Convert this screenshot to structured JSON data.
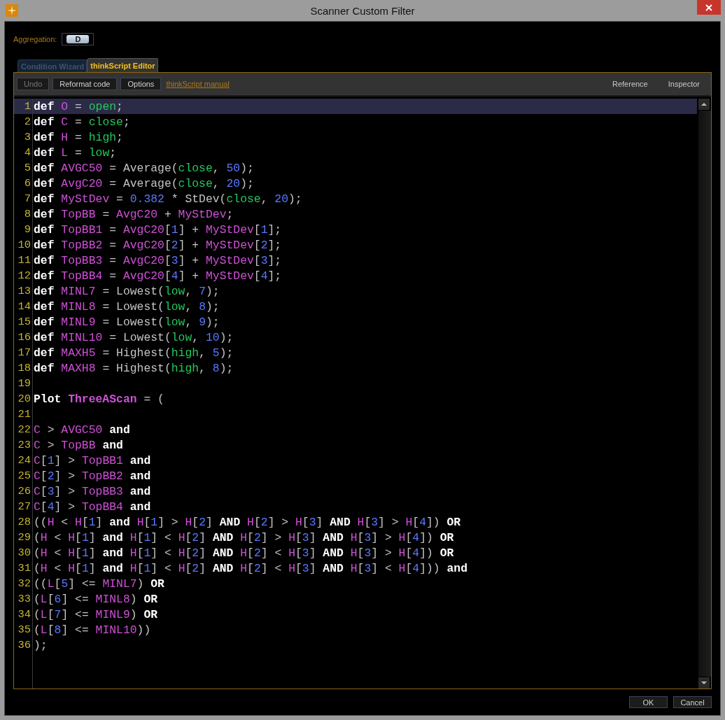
{
  "window": {
    "title": "Scanner Custom Filter"
  },
  "aggregation": {
    "label": "Aggregation:",
    "value": "D"
  },
  "tabs": [
    {
      "label": "Condition Wizard",
      "selected": false
    },
    {
      "label": "thinkScript Editor",
      "selected": true
    }
  ],
  "toolbar": {
    "buttons": [
      {
        "label": "Undo",
        "disabled": true
      },
      {
        "label": "Reformat code",
        "disabled": false
      },
      {
        "label": "Options",
        "disabled": false
      }
    ],
    "link": "thinkScript manual",
    "right_buttons": [
      "Reference",
      "Inspector"
    ]
  },
  "editor": {
    "lines": [
      {
        "number": "1",
        "selected": true,
        "tokens": [
          {
            "kind": "keyword",
            "text": "def "
          },
          {
            "kind": "variable",
            "text": "O"
          },
          {
            "kind": "operator",
            "text": " = "
          },
          {
            "kind": "function",
            "text": "open"
          },
          {
            "kind": "operator",
            "text": ";"
          }
        ]
      },
      {
        "number": "2",
        "selected": false,
        "tokens": [
          {
            "kind": "keyword",
            "text": "def "
          },
          {
            "kind": "variable",
            "text": "C"
          },
          {
            "kind": "operator",
            "text": " = "
          },
          {
            "kind": "function",
            "text": "close"
          },
          {
            "kind": "operator",
            "text": ";"
          }
        ]
      },
      {
        "number": "3",
        "selected": false,
        "tokens": [
          {
            "kind": "keyword",
            "text": "def "
          },
          {
            "kind": "variable",
            "text": "H"
          },
          {
            "kind": "operator",
            "text": " = "
          },
          {
            "kind": "function",
            "text": "high"
          },
          {
            "kind": "operator",
            "text": ";"
          }
        ]
      },
      {
        "number": "4",
        "selected": false,
        "tokens": [
          {
            "kind": "keyword",
            "text": "def "
          },
          {
            "kind": "variable",
            "text": "L"
          },
          {
            "kind": "operator",
            "text": " = "
          },
          {
            "kind": "function",
            "text": "low"
          },
          {
            "kind": "operator",
            "text": ";"
          }
        ]
      },
      {
        "number": "5",
        "selected": false,
        "tokens": [
          {
            "kind": "keyword",
            "text": "def "
          },
          {
            "kind": "variable",
            "text": "AVGC50"
          },
          {
            "kind": "operator",
            "text": " = Average("
          },
          {
            "kind": "function",
            "text": "close"
          },
          {
            "kind": "operator",
            "text": ", "
          },
          {
            "kind": "number",
            "text": "50"
          },
          {
            "kind": "operator",
            "text": ");"
          }
        ]
      },
      {
        "number": "6",
        "selected": false,
        "tokens": [
          {
            "kind": "keyword",
            "text": "def "
          },
          {
            "kind": "variable",
            "text": "AvgC20"
          },
          {
            "kind": "operator",
            "text": " = Average("
          },
          {
            "kind": "function",
            "text": "close"
          },
          {
            "kind": "operator",
            "text": ", "
          },
          {
            "kind": "number",
            "text": "20"
          },
          {
            "kind": "operator",
            "text": ");"
          }
        ]
      },
      {
        "number": "7",
        "selected": false,
        "tokens": [
          {
            "kind": "keyword",
            "text": "def "
          },
          {
            "kind": "variable",
            "text": "MyStDev"
          },
          {
            "kind": "operator",
            "text": " = "
          },
          {
            "kind": "number",
            "text": "0.382"
          },
          {
            "kind": "operator",
            "text": " * StDev("
          },
          {
            "kind": "function",
            "text": "close"
          },
          {
            "kind": "operator",
            "text": ", "
          },
          {
            "kind": "number",
            "text": "20"
          },
          {
            "kind": "operator",
            "text": ");"
          }
        ]
      },
      {
        "number": "8",
        "selected": false,
        "tokens": [
          {
            "kind": "keyword",
            "text": "def "
          },
          {
            "kind": "variable",
            "text": "TopBB"
          },
          {
            "kind": "operator",
            "text": " = "
          },
          {
            "kind": "variable",
            "text": "AvgC20"
          },
          {
            "kind": "operator",
            "text": " + "
          },
          {
            "kind": "variable",
            "text": "MyStDev"
          },
          {
            "kind": "operator",
            "text": ";"
          }
        ]
      },
      {
        "number": "9",
        "selected": false,
        "tokens": [
          {
            "kind": "keyword",
            "text": "def "
          },
          {
            "kind": "variable",
            "text": "TopBB1"
          },
          {
            "kind": "operator",
            "text": " = "
          },
          {
            "kind": "variable",
            "text": "AvgC20"
          },
          {
            "kind": "operator",
            "text": "["
          },
          {
            "kind": "number",
            "text": "1"
          },
          {
            "kind": "operator",
            "text": "] + "
          },
          {
            "kind": "variable",
            "text": "MyStDev"
          },
          {
            "kind": "operator",
            "text": "["
          },
          {
            "kind": "number",
            "text": "1"
          },
          {
            "kind": "operator",
            "text": "];"
          }
        ]
      },
      {
        "number": "10",
        "selected": false,
        "tokens": [
          {
            "kind": "keyword",
            "text": "def "
          },
          {
            "kind": "variable",
            "text": "TopBB2"
          },
          {
            "kind": "operator",
            "text": " = "
          },
          {
            "kind": "variable",
            "text": "AvgC20"
          },
          {
            "kind": "operator",
            "text": "["
          },
          {
            "kind": "number",
            "text": "2"
          },
          {
            "kind": "operator",
            "text": "] + "
          },
          {
            "kind": "variable",
            "text": "MyStDev"
          },
          {
            "kind": "operator",
            "text": "["
          },
          {
            "kind": "number",
            "text": "2"
          },
          {
            "kind": "operator",
            "text": "];"
          }
        ]
      },
      {
        "number": "11",
        "selected": false,
        "tokens": [
          {
            "kind": "keyword",
            "text": "def "
          },
          {
            "kind": "variable",
            "text": "TopBB3"
          },
          {
            "kind": "operator",
            "text": " = "
          },
          {
            "kind": "variable",
            "text": "AvgC20"
          },
          {
            "kind": "operator",
            "text": "["
          },
          {
            "kind": "number",
            "text": "3"
          },
          {
            "kind": "operator",
            "text": "] + "
          },
          {
            "kind": "variable",
            "text": "MyStDev"
          },
          {
            "kind": "operator",
            "text": "["
          },
          {
            "kind": "number",
            "text": "3"
          },
          {
            "kind": "operator",
            "text": "];"
          }
        ]
      },
      {
        "number": "12",
        "selected": false,
        "tokens": [
          {
            "kind": "keyword",
            "text": "def "
          },
          {
            "kind": "variable",
            "text": "TopBB4"
          },
          {
            "kind": "operator",
            "text": " = "
          },
          {
            "kind": "variable",
            "text": "AvgC20"
          },
          {
            "kind": "operator",
            "text": "["
          },
          {
            "kind": "number",
            "text": "4"
          },
          {
            "kind": "operator",
            "text": "] + "
          },
          {
            "kind": "variable",
            "text": "MyStDev"
          },
          {
            "kind": "operator",
            "text": "["
          },
          {
            "kind": "number",
            "text": "4"
          },
          {
            "kind": "operator",
            "text": "];"
          }
        ]
      },
      {
        "number": "13",
        "selected": false,
        "tokens": [
          {
            "kind": "keyword",
            "text": "def "
          },
          {
            "kind": "variable",
            "text": "MINL7"
          },
          {
            "kind": "operator",
            "text": " = Lowest("
          },
          {
            "kind": "function",
            "text": "low"
          },
          {
            "kind": "operator",
            "text": ", "
          },
          {
            "kind": "number",
            "text": "7"
          },
          {
            "kind": "operator",
            "text": ");"
          }
        ]
      },
      {
        "number": "14",
        "selected": false,
        "tokens": [
          {
            "kind": "keyword",
            "text": "def "
          },
          {
            "kind": "variable",
            "text": "MINL8"
          },
          {
            "kind": "operator",
            "text": " = Lowest("
          },
          {
            "kind": "function",
            "text": "low"
          },
          {
            "kind": "operator",
            "text": ", "
          },
          {
            "kind": "number",
            "text": "8"
          },
          {
            "kind": "operator",
            "text": ");"
          }
        ]
      },
      {
        "number": "15",
        "selected": false,
        "tokens": [
          {
            "kind": "keyword",
            "text": "def "
          },
          {
            "kind": "variable",
            "text": "MINL9"
          },
          {
            "kind": "operator",
            "text": " = Lowest("
          },
          {
            "kind": "function",
            "text": "low"
          },
          {
            "kind": "operator",
            "text": ", "
          },
          {
            "kind": "number",
            "text": "9"
          },
          {
            "kind": "operator",
            "text": ");"
          }
        ]
      },
      {
        "number": "16",
        "selected": false,
        "tokens": [
          {
            "kind": "keyword",
            "text": "def "
          },
          {
            "kind": "variable",
            "text": "MINL10"
          },
          {
            "kind": "operator",
            "text": " = Lowest("
          },
          {
            "kind": "function",
            "text": "low"
          },
          {
            "kind": "operator",
            "text": ", "
          },
          {
            "kind": "number",
            "text": "10"
          },
          {
            "kind": "operator",
            "text": ");"
          }
        ]
      },
      {
        "number": "17",
        "selected": false,
        "tokens": [
          {
            "kind": "keyword",
            "text": "def "
          },
          {
            "kind": "variable",
            "text": "MAXH5"
          },
          {
            "kind": "operator",
            "text": " = Highest("
          },
          {
            "kind": "function",
            "text": "high"
          },
          {
            "kind": "operator",
            "text": ", "
          },
          {
            "kind": "number",
            "text": "5"
          },
          {
            "kind": "operator",
            "text": ");"
          }
        ]
      },
      {
        "number": "18",
        "selected": false,
        "tokens": [
          {
            "kind": "keyword",
            "text": "def "
          },
          {
            "kind": "variable",
            "text": "MAXH8"
          },
          {
            "kind": "operator",
            "text": " = Highest("
          },
          {
            "kind": "function",
            "text": "high"
          },
          {
            "kind": "operator",
            "text": ", "
          },
          {
            "kind": "number",
            "text": "8"
          },
          {
            "kind": "operator",
            "text": ");"
          }
        ]
      },
      {
        "number": "19",
        "selected": false
      },
      {
        "number": "20",
        "selected": false,
        "tokens": [
          {
            "kind": "keyword",
            "text": "Plot "
          },
          {
            "kind": "name",
            "text": "ThreeAScan"
          },
          {
            "kind": "operator",
            "text": " = ("
          }
        ]
      },
      {
        "number": "21",
        "selected": false
      },
      {
        "number": "22",
        "selected": false,
        "tokens": [
          {
            "kind": "variable",
            "text": "C"
          },
          {
            "kind": "operator",
            "text": " > "
          },
          {
            "kind": "variable",
            "text": "AVGC50"
          },
          {
            "kind": "keyword",
            "text": " and"
          }
        ]
      },
      {
        "number": "23",
        "selected": false,
        "tokens": [
          {
            "kind": "variable",
            "text": "C"
          },
          {
            "kind": "operator",
            "text": " > "
          },
          {
            "kind": "variable",
            "text": "TopBB"
          },
          {
            "kind": "keyword",
            "text": " and"
          }
        ]
      },
      {
        "number": "24",
        "selected": false,
        "tokens": [
          {
            "kind": "variable",
            "text": "C"
          },
          {
            "kind": "operator",
            "text": "["
          },
          {
            "kind": "number",
            "text": "1"
          },
          {
            "kind": "operator",
            "text": "] > "
          },
          {
            "kind": "variable",
            "text": "TopBB1"
          },
          {
            "kind": "keyword",
            "text": " and"
          }
        ]
      },
      {
        "number": "25",
        "selected": false,
        "tokens": [
          {
            "kind": "variable",
            "text": "C"
          },
          {
            "kind": "operator",
            "text": "["
          },
          {
            "kind": "number",
            "text": "2"
          },
          {
            "kind": "operator",
            "text": "] > "
          },
          {
            "kind": "variable",
            "text": "TopBB2"
          },
          {
            "kind": "keyword",
            "text": " and"
          }
        ]
      },
      {
        "number": "26",
        "selected": false,
        "tokens": [
          {
            "kind": "variable",
            "text": "C"
          },
          {
            "kind": "operator",
            "text": "["
          },
          {
            "kind": "number",
            "text": "3"
          },
          {
            "kind": "operator",
            "text": "] > "
          },
          {
            "kind": "variable",
            "text": "TopBB3"
          },
          {
            "kind": "keyword",
            "text": " and"
          }
        ]
      },
      {
        "number": "27",
        "selected": false,
        "tokens": [
          {
            "kind": "variable",
            "text": "C"
          },
          {
            "kind": "operator",
            "text": "["
          },
          {
            "kind": "number",
            "text": "4"
          },
          {
            "kind": "operator",
            "text": "] > "
          },
          {
            "kind": "variable",
            "text": "TopBB4"
          },
          {
            "kind": "keyword",
            "text": " and"
          }
        ]
      },
      {
        "number": "28",
        "selected": false,
        "tokens": [
          {
            "kind": "operator",
            "text": "(("
          },
          {
            "kind": "variable",
            "text": "H"
          },
          {
            "kind": "operator",
            "text": " < "
          },
          {
            "kind": "variable",
            "text": "H"
          },
          {
            "kind": "operator",
            "text": "["
          },
          {
            "kind": "number",
            "text": "1"
          },
          {
            "kind": "operator",
            "text": "] "
          },
          {
            "kind": "keyword",
            "text": "and "
          },
          {
            "kind": "variable",
            "text": "H"
          },
          {
            "kind": "operator",
            "text": "["
          },
          {
            "kind": "number",
            "text": "1"
          },
          {
            "kind": "operator",
            "text": "] > "
          },
          {
            "kind": "variable",
            "text": "H"
          },
          {
            "kind": "operator",
            "text": "["
          },
          {
            "kind": "number",
            "text": "2"
          },
          {
            "kind": "operator",
            "text": "] "
          },
          {
            "kind": "keyword",
            "text": "AND "
          },
          {
            "kind": "variable",
            "text": "H"
          },
          {
            "kind": "operator",
            "text": "["
          },
          {
            "kind": "number",
            "text": "2"
          },
          {
            "kind": "operator",
            "text": "] > "
          },
          {
            "kind": "variable",
            "text": "H"
          },
          {
            "kind": "operator",
            "text": "["
          },
          {
            "kind": "number",
            "text": "3"
          },
          {
            "kind": "operator",
            "text": "] "
          },
          {
            "kind": "keyword",
            "text": "AND "
          },
          {
            "kind": "variable",
            "text": "H"
          },
          {
            "kind": "operator",
            "text": "["
          },
          {
            "kind": "number",
            "text": "3"
          },
          {
            "kind": "operator",
            "text": "] > "
          },
          {
            "kind": "variable",
            "text": "H"
          },
          {
            "kind": "operator",
            "text": "["
          },
          {
            "kind": "number",
            "text": "4"
          },
          {
            "kind": "operator",
            "text": "]) "
          },
          {
            "kind": "keyword",
            "text": "OR"
          }
        ]
      },
      {
        "number": "29",
        "selected": false,
        "tokens": [
          {
            "kind": "operator",
            "text": "("
          },
          {
            "kind": "variable",
            "text": "H"
          },
          {
            "kind": "operator",
            "text": " < "
          },
          {
            "kind": "variable",
            "text": "H"
          },
          {
            "kind": "operator",
            "text": "["
          },
          {
            "kind": "number",
            "text": "1"
          },
          {
            "kind": "operator",
            "text": "] "
          },
          {
            "kind": "keyword",
            "text": "and "
          },
          {
            "kind": "variable",
            "text": "H"
          },
          {
            "kind": "operator",
            "text": "["
          },
          {
            "kind": "number",
            "text": "1"
          },
          {
            "kind": "operator",
            "text": "] < "
          },
          {
            "kind": "variable",
            "text": "H"
          },
          {
            "kind": "operator",
            "text": "["
          },
          {
            "kind": "number",
            "text": "2"
          },
          {
            "kind": "operator",
            "text": "] "
          },
          {
            "kind": "keyword",
            "text": "AND "
          },
          {
            "kind": "variable",
            "text": "H"
          },
          {
            "kind": "operator",
            "text": "["
          },
          {
            "kind": "number",
            "text": "2"
          },
          {
            "kind": "operator",
            "text": "] > "
          },
          {
            "kind": "variable",
            "text": "H"
          },
          {
            "kind": "operator",
            "text": "["
          },
          {
            "kind": "number",
            "text": "3"
          },
          {
            "kind": "operator",
            "text": "] "
          },
          {
            "kind": "keyword",
            "text": "AND "
          },
          {
            "kind": "variable",
            "text": "H"
          },
          {
            "kind": "operator",
            "text": "["
          },
          {
            "kind": "number",
            "text": "3"
          },
          {
            "kind": "operator",
            "text": "] > "
          },
          {
            "kind": "variable",
            "text": "H"
          },
          {
            "kind": "operator",
            "text": "["
          },
          {
            "kind": "number",
            "text": "4"
          },
          {
            "kind": "operator",
            "text": "]) "
          },
          {
            "kind": "keyword",
            "text": "OR"
          }
        ]
      },
      {
        "number": "30",
        "selected": false,
        "tokens": [
          {
            "kind": "operator",
            "text": "("
          },
          {
            "kind": "variable",
            "text": "H"
          },
          {
            "kind": "operator",
            "text": " < "
          },
          {
            "kind": "variable",
            "text": "H"
          },
          {
            "kind": "operator",
            "text": "["
          },
          {
            "kind": "number",
            "text": "1"
          },
          {
            "kind": "operator",
            "text": "] "
          },
          {
            "kind": "keyword",
            "text": "and "
          },
          {
            "kind": "variable",
            "text": "H"
          },
          {
            "kind": "operator",
            "text": "["
          },
          {
            "kind": "number",
            "text": "1"
          },
          {
            "kind": "operator",
            "text": "] < "
          },
          {
            "kind": "variable",
            "text": "H"
          },
          {
            "kind": "operator",
            "text": "["
          },
          {
            "kind": "number",
            "text": "2"
          },
          {
            "kind": "operator",
            "text": "] "
          },
          {
            "kind": "keyword",
            "text": "AND "
          },
          {
            "kind": "variable",
            "text": "H"
          },
          {
            "kind": "operator",
            "text": "["
          },
          {
            "kind": "number",
            "text": "2"
          },
          {
            "kind": "operator",
            "text": "] < "
          },
          {
            "kind": "variable",
            "text": "H"
          },
          {
            "kind": "operator",
            "text": "["
          },
          {
            "kind": "number",
            "text": "3"
          },
          {
            "kind": "operator",
            "text": "] "
          },
          {
            "kind": "keyword",
            "text": "AND "
          },
          {
            "kind": "variable",
            "text": "H"
          },
          {
            "kind": "operator",
            "text": "["
          },
          {
            "kind": "number",
            "text": "3"
          },
          {
            "kind": "operator",
            "text": "] > "
          },
          {
            "kind": "variable",
            "text": "H"
          },
          {
            "kind": "operator",
            "text": "["
          },
          {
            "kind": "number",
            "text": "4"
          },
          {
            "kind": "operator",
            "text": "]) "
          },
          {
            "kind": "keyword",
            "text": "OR"
          }
        ]
      },
      {
        "number": "31",
        "selected": false,
        "tokens": [
          {
            "kind": "operator",
            "text": "("
          },
          {
            "kind": "variable",
            "text": "H"
          },
          {
            "kind": "operator",
            "text": " < "
          },
          {
            "kind": "variable",
            "text": "H"
          },
          {
            "kind": "operator",
            "text": "["
          },
          {
            "kind": "number",
            "text": "1"
          },
          {
            "kind": "operator",
            "text": "] "
          },
          {
            "kind": "keyword",
            "text": "and "
          },
          {
            "kind": "variable",
            "text": "H"
          },
          {
            "kind": "operator",
            "text": "["
          },
          {
            "kind": "number",
            "text": "1"
          },
          {
            "kind": "operator",
            "text": "] < "
          },
          {
            "kind": "variable",
            "text": "H"
          },
          {
            "kind": "operator",
            "text": "["
          },
          {
            "kind": "number",
            "text": "2"
          },
          {
            "kind": "operator",
            "text": "] "
          },
          {
            "kind": "keyword",
            "text": "AND "
          },
          {
            "kind": "variable",
            "text": "H"
          },
          {
            "kind": "operator",
            "text": "["
          },
          {
            "kind": "number",
            "text": "2"
          },
          {
            "kind": "operator",
            "text": "] < "
          },
          {
            "kind": "variable",
            "text": "H"
          },
          {
            "kind": "operator",
            "text": "["
          },
          {
            "kind": "number",
            "text": "3"
          },
          {
            "kind": "operator",
            "text": "] "
          },
          {
            "kind": "keyword",
            "text": "AND "
          },
          {
            "kind": "variable",
            "text": "H"
          },
          {
            "kind": "operator",
            "text": "["
          },
          {
            "kind": "number",
            "text": "3"
          },
          {
            "kind": "operator",
            "text": "] < "
          },
          {
            "kind": "variable",
            "text": "H"
          },
          {
            "kind": "operator",
            "text": "["
          },
          {
            "kind": "number",
            "text": "4"
          },
          {
            "kind": "operator",
            "text": "])) "
          },
          {
            "kind": "keyword",
            "text": "and"
          }
        ]
      },
      {
        "number": "32",
        "selected": false,
        "tokens": [
          {
            "kind": "operator",
            "text": "(("
          },
          {
            "kind": "variable",
            "text": "L"
          },
          {
            "kind": "operator",
            "text": "["
          },
          {
            "kind": "number",
            "text": "5"
          },
          {
            "kind": "operator",
            "text": "] <= "
          },
          {
            "kind": "variable",
            "text": "MINL7"
          },
          {
            "kind": "operator",
            "text": ") "
          },
          {
            "kind": "keyword",
            "text": "OR"
          }
        ]
      },
      {
        "number": "33",
        "selected": false,
        "tokens": [
          {
            "kind": "operator",
            "text": "("
          },
          {
            "kind": "variable",
            "text": "L"
          },
          {
            "kind": "operator",
            "text": "["
          },
          {
            "kind": "number",
            "text": "6"
          },
          {
            "kind": "operator",
            "text": "] <= "
          },
          {
            "kind": "variable",
            "text": "MINL8"
          },
          {
            "kind": "operator",
            "text": ") "
          },
          {
            "kind": "keyword",
            "text": "OR"
          }
        ]
      },
      {
        "number": "34",
        "selected": false,
        "tokens": [
          {
            "kind": "operator",
            "text": "("
          },
          {
            "kind": "variable",
            "text": "L"
          },
          {
            "kind": "operator",
            "text": "["
          },
          {
            "kind": "number",
            "text": "7"
          },
          {
            "kind": "operator",
            "text": "] <= "
          },
          {
            "kind": "variable",
            "text": "MINL9"
          },
          {
            "kind": "operator",
            "text": ") "
          },
          {
            "kind": "keyword",
            "text": "OR"
          }
        ]
      },
      {
        "number": "35",
        "selected": false,
        "tokens": [
          {
            "kind": "operator",
            "text": "("
          },
          {
            "kind": "variable",
            "text": "L"
          },
          {
            "kind": "operator",
            "text": "["
          },
          {
            "kind": "number",
            "text": "8"
          },
          {
            "kind": "operator",
            "text": "] <= "
          },
          {
            "kind": "variable",
            "text": "MINL10"
          },
          {
            "kind": "operator",
            "text": "))"
          }
        ]
      },
      {
        "number": "36",
        "selected": false,
        "tokens": [
          {
            "kind": "operator",
            "text": ");"
          }
        ]
      }
    ]
  },
  "buttons": [
    "OK",
    "Cancel"
  ]
}
